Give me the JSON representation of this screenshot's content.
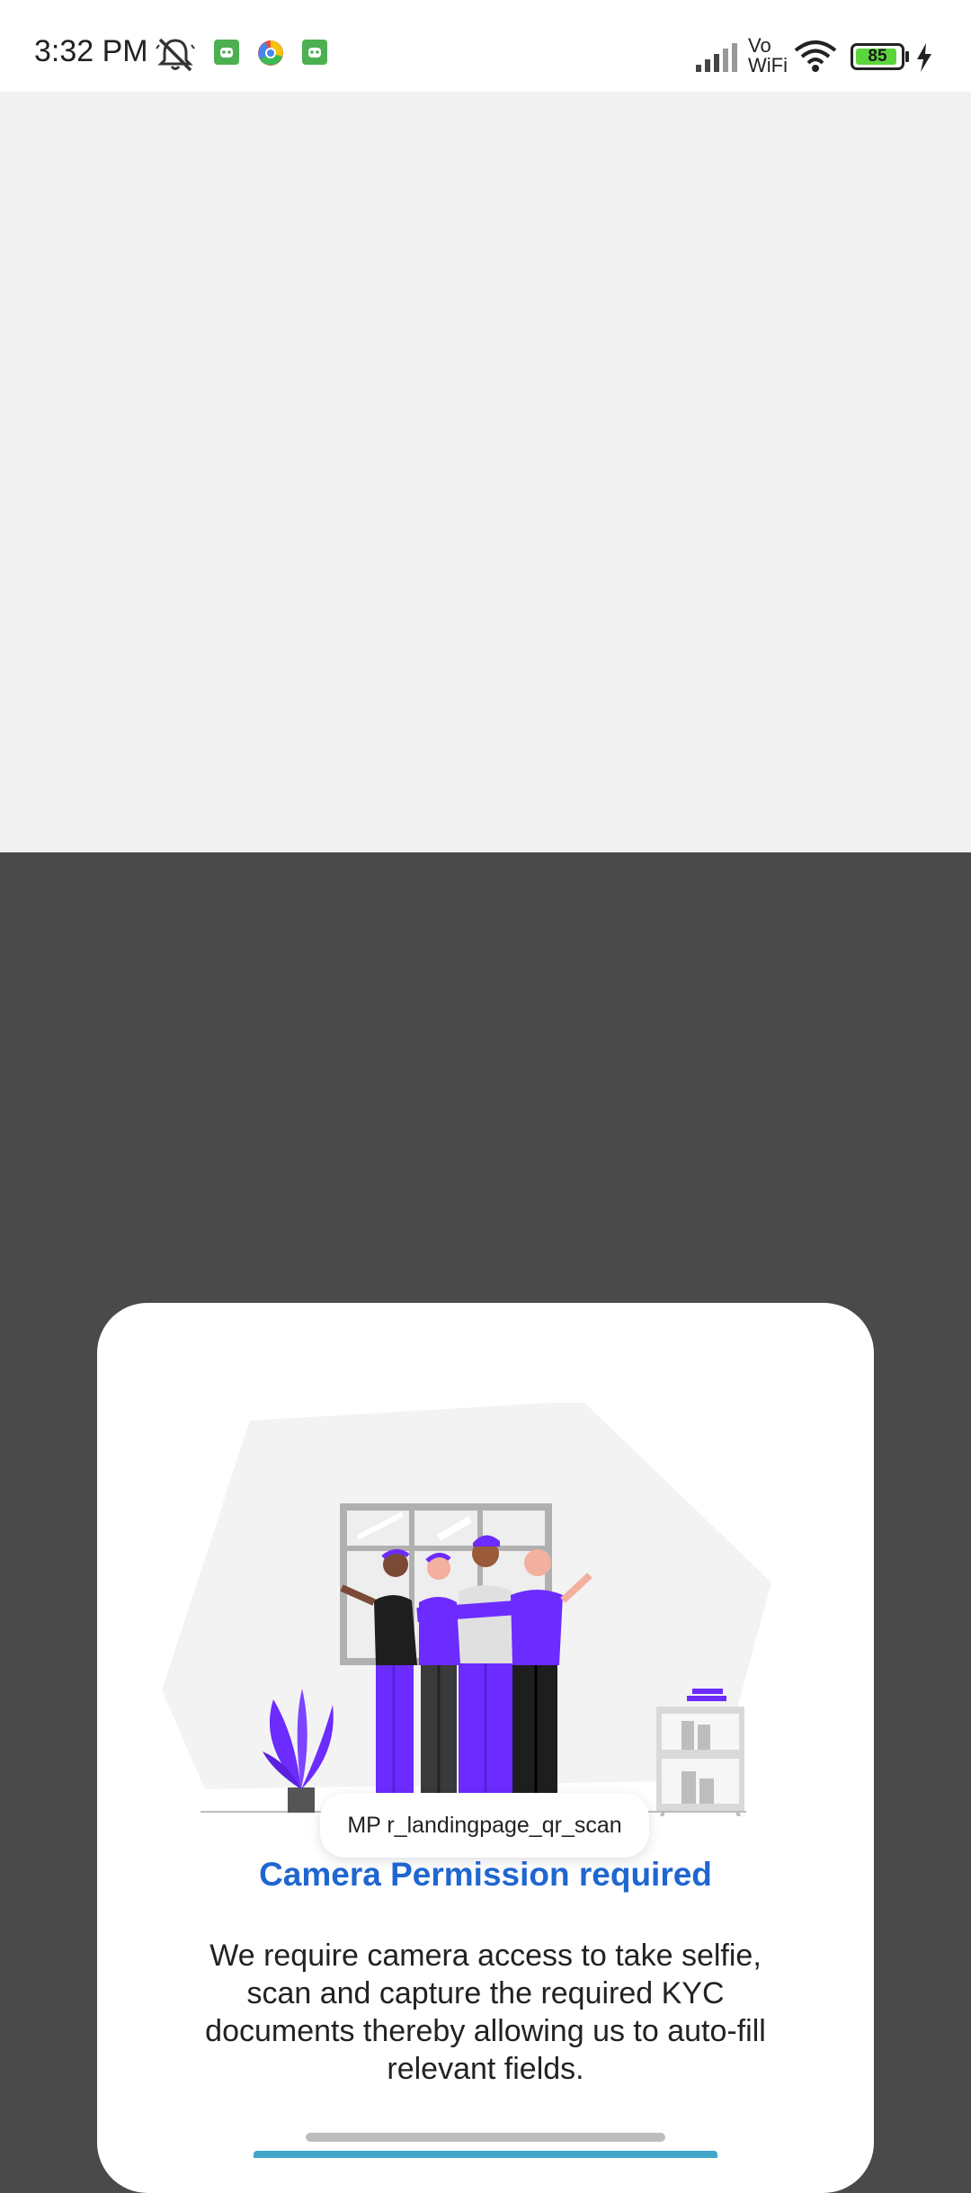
{
  "status_bar": {
    "time": "3:32 PM",
    "battery": "85",
    "network": "Vo WiFi",
    "network_line1": "Vo",
    "network_line2": "WiFi"
  },
  "dialog": {
    "toast_text": "MP r_landingpage_qr_scan",
    "title": "Camera Permission required",
    "description": "We require camera access to take selfie, scan and capture the required KYC documents thereby allowing us to auto-fill relevant fields."
  },
  "colors": {
    "accent": "#1f66d1",
    "illustration_purple": "#6c2bff",
    "scrim": "#4a4a4a",
    "background": "#f1f1f1"
  }
}
